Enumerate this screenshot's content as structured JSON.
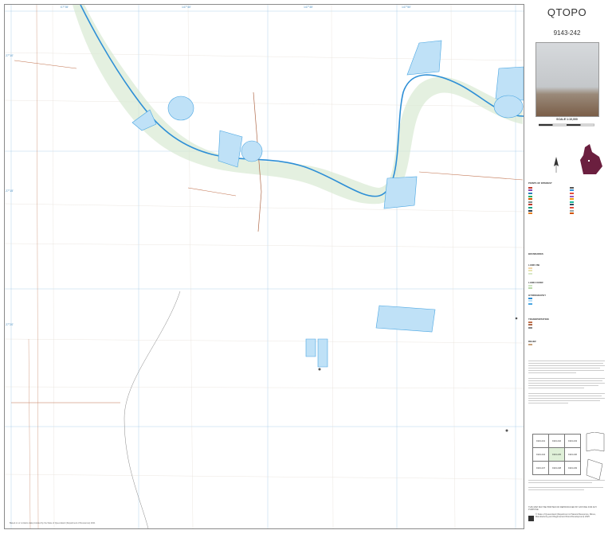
{
  "map": {
    "grid_top": [
      "Ɛ7°35'",
      "147°40'",
      "147°45'",
      "147°50'"
    ],
    "grid_left": [
      "27°10'",
      "27°15'",
      "27°20'"
    ],
    "footer_text": "Based on or contains data provided by the State of Queensland (Department of Resources) 2021"
  },
  "panel": {
    "app_title": "QTOPO",
    "sheet_id": "9143-242",
    "scale": "SCALE 1:10,000",
    "legend_heading": "POINTS OF INTEREST",
    "boundaries": "BOUNDARIES",
    "land_use": "LAND USE",
    "land_cover": "LAND COVER",
    "hydrography": "HYDROGRAPHY",
    "transportation": "TRANSPORTATION",
    "relief": "RELIEF",
    "note_print": "THIS MAP MAY BE PRINTED OR REPRODUCED BY ANYONE FOR ANY PURPOSE",
    "index_cells": [
      "9143-241",
      "9143-242",
      "9143-243",
      "9143-244",
      "9143-245",
      "9143-246",
      "9143-247",
      "9143-248",
      "9143-249"
    ],
    "copyright": "© State of Queensland (Department of Natural Resources, Mines, Manufacturing and Regional and Rural Development) 2025"
  }
}
